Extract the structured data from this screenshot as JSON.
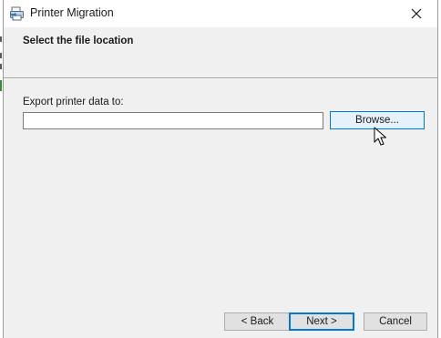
{
  "window": {
    "title": "Printer Migration",
    "close_icon": "close-icon",
    "app_icon": "printer-migration-icon"
  },
  "header": {
    "title": "Select the file location"
  },
  "form": {
    "export_label": "Export printer data to:",
    "path_value": "",
    "browse_label": "Browse..."
  },
  "footer": {
    "back_label": "< Back",
    "next_label": "Next >",
    "cancel_label": "Cancel"
  },
  "colors": {
    "dialog_bg": "#f0f0f0",
    "titlebar_bg": "#ffffff",
    "focus_accent": "#0078d7",
    "button_bg": "#e1e1e1"
  }
}
